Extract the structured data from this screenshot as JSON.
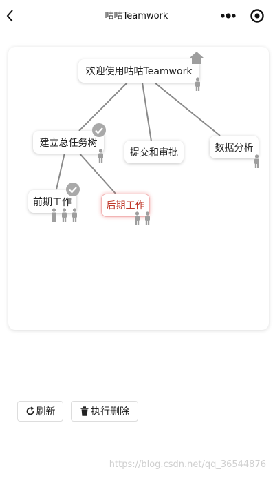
{
  "navbar": {
    "title": "咕咕Teamwork"
  },
  "tree": {
    "nodes": [
      {
        "id": "root",
        "label": "欢迎使用咕咕Teamwork",
        "members": 1,
        "completed": false,
        "is_home": true,
        "selected": false
      },
      {
        "id": "n1",
        "label": "建立总任务树",
        "members": 1,
        "completed": true,
        "is_home": false,
        "selected": false
      },
      {
        "id": "n2",
        "label": "提交和审批",
        "members": 0,
        "completed": false,
        "is_home": false,
        "selected": false
      },
      {
        "id": "n3",
        "label": "数据分析",
        "members": 1,
        "completed": false,
        "is_home": false,
        "selected": false
      },
      {
        "id": "n4",
        "label": "前期工作",
        "members": 3,
        "completed": true,
        "is_home": false,
        "selected": false
      },
      {
        "id": "n5",
        "label": "后期工作",
        "members": 2,
        "completed": false,
        "is_home": false,
        "selected": true
      }
    ],
    "edges": [
      [
        "root",
        "n1"
      ],
      [
        "root",
        "n2"
      ],
      [
        "root",
        "n3"
      ],
      [
        "n1",
        "n4"
      ],
      [
        "n1",
        "n5"
      ]
    ]
  },
  "toolbar": {
    "refresh_label": "刷新",
    "delete_label": "执行删除"
  },
  "footer": {
    "watermark": "https://blog.csdn.net/qq_36544876"
  },
  "colors": {
    "selected_text": "#c0392b",
    "selected_glow": "#e65050",
    "icon_gray": "#9e9e9e",
    "line": "#8a8a8a"
  }
}
